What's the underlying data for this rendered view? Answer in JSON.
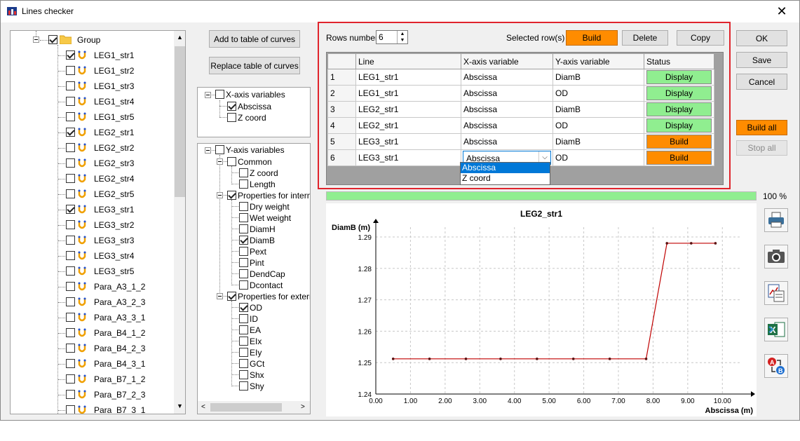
{
  "window": {
    "title": "Lines checker"
  },
  "left_tree": {
    "group_label": "Group",
    "items": [
      {
        "label": "LEG1_str1",
        "checked": true
      },
      {
        "label": "LEG1_str2",
        "checked": false
      },
      {
        "label": "LEG1_str3",
        "checked": false
      },
      {
        "label": "LEG1_str4",
        "checked": false
      },
      {
        "label": "LEG1_str5",
        "checked": false
      },
      {
        "label": "LEG2_str1",
        "checked": true
      },
      {
        "label": "LEG2_str2",
        "checked": false
      },
      {
        "label": "LEG2_str3",
        "checked": false
      },
      {
        "label": "LEG2_str4",
        "checked": false
      },
      {
        "label": "LEG2_str5",
        "checked": false
      },
      {
        "label": "LEG3_str1",
        "checked": true
      },
      {
        "label": "LEG3_str2",
        "checked": false
      },
      {
        "label": "LEG3_str3",
        "checked": false
      },
      {
        "label": "LEG3_str4",
        "checked": false
      },
      {
        "label": "LEG3_str5",
        "checked": false
      },
      {
        "label": "Para_A3_1_2",
        "checked": false
      },
      {
        "label": "Para_A3_2_3",
        "checked": false
      },
      {
        "label": "Para_A3_3_1",
        "checked": false
      },
      {
        "label": "Para_B4_1_2",
        "checked": false
      },
      {
        "label": "Para_B4_2_3",
        "checked": false
      },
      {
        "label": "Para_B4_3_1",
        "checked": false
      },
      {
        "label": "Para_B7_1_2",
        "checked": false
      },
      {
        "label": "Para_B7_2_3",
        "checked": false
      },
      {
        "label": "Para_B7_3_1",
        "checked": false
      }
    ]
  },
  "middle": {
    "add_button": "Add to table of curves",
    "replace_button": "Replace table of curves",
    "x_tree": {
      "root_label": "X-axis variables",
      "items": [
        {
          "label": "Abscissa",
          "checked": true
        },
        {
          "label": "Z coord",
          "checked": false
        }
      ]
    },
    "y_tree": {
      "root_label": "Y-axis variables",
      "groups": [
        {
          "label": "Common",
          "checked": false,
          "items": [
            {
              "label": "Z coord",
              "checked": false
            },
            {
              "label": "Length",
              "checked": false
            }
          ]
        },
        {
          "label": "Properties for internal",
          "checked": true,
          "items": [
            {
              "label": "Dry weight",
              "checked": false
            },
            {
              "label": "Wet weight",
              "checked": false
            },
            {
              "label": "DiamH",
              "checked": false
            },
            {
              "label": "DiamB",
              "checked": true
            },
            {
              "label": "Pext",
              "checked": false
            },
            {
              "label": "Pint",
              "checked": false
            },
            {
              "label": "DendCap",
              "checked": false
            },
            {
              "label": "Dcontact",
              "checked": false
            }
          ]
        },
        {
          "label": "Properties for external",
          "checked": true,
          "items": [
            {
              "label": "OD",
              "checked": true
            },
            {
              "label": "ID",
              "checked": false
            },
            {
              "label": "EA",
              "checked": false
            },
            {
              "label": "EIx",
              "checked": false
            },
            {
              "label": "EIy",
              "checked": false
            },
            {
              "label": "GCt",
              "checked": false
            },
            {
              "label": "Shx",
              "checked": false
            },
            {
              "label": "Shy",
              "checked": false
            }
          ]
        }
      ]
    }
  },
  "table_panel": {
    "rows_number_label": "Rows number",
    "rows_number_value": "6",
    "selected_rows_label": "Selected row(s)",
    "build_label": "Build",
    "delete_label": "Delete",
    "copy_label": "Copy",
    "headers": [
      "",
      "Line",
      "X-axis variable",
      "Y-axis variable",
      "Status"
    ],
    "rows": [
      {
        "num": "1",
        "line": "LEG1_str1",
        "x": "Abscissa",
        "y": "DiamB",
        "status": "Display"
      },
      {
        "num": "2",
        "line": "LEG1_str1",
        "x": "Abscissa",
        "y": "OD",
        "status": "Display"
      },
      {
        "num": "3",
        "line": "LEG2_str1",
        "x": "Abscissa",
        "y": "DiamB",
        "status": "Display"
      },
      {
        "num": "4",
        "line": "LEG2_str1",
        "x": "Abscissa",
        "y": "OD",
        "status": "Display"
      },
      {
        "num": "5",
        "line": "LEG3_str1",
        "x": "Abscissa",
        "y": "DiamB",
        "status": "Build"
      },
      {
        "num": "6",
        "line": "LEG3_str1",
        "x": "Abscissa",
        "y": "OD",
        "status": "Build"
      }
    ],
    "dropdown_value": "Abscissa",
    "dropdown_options": [
      "Abscissa",
      "Z coord"
    ]
  },
  "right_buttons": {
    "ok": "OK",
    "save": "Save",
    "cancel": "Cancel",
    "build_all": "Build all",
    "stop_all": "Stop all"
  },
  "progress": {
    "percent_label": "100 %",
    "fraction": 1.0
  },
  "chart_data": {
    "type": "line",
    "title": "LEG2_str1",
    "xlabel": "Abscissa (m)",
    "ylabel": "DiamB (m)",
    "xlim": [
      0,
      10.5
    ],
    "ylim": [
      1.24,
      1.29
    ],
    "xticks": [
      "0.00",
      "1.00",
      "2.00",
      "3.00",
      "4.00",
      "5.00",
      "6.00",
      "7.00",
      "8.00",
      "9.00",
      "10.00"
    ],
    "yticks": [
      "1.24",
      "1.25",
      "1.26",
      "1.27",
      "1.28",
      "1.29"
    ],
    "grid": true,
    "series": [
      {
        "color": "#c00000",
        "x": [
          0.5,
          1.55,
          2.6,
          3.6,
          4.65,
          5.7,
          6.75,
          7.8,
          8.4,
          9.1,
          9.8
        ],
        "y": [
          1.2512,
          1.2512,
          1.2512,
          1.2512,
          1.2512,
          1.2512,
          1.2512,
          1.2512,
          1.288,
          1.288,
          1.288
        ]
      }
    ]
  },
  "icons": [
    "printer-icon",
    "camera-icon",
    "copy-chart-icon",
    "excel-export-icon",
    "swap-ab-icon"
  ]
}
